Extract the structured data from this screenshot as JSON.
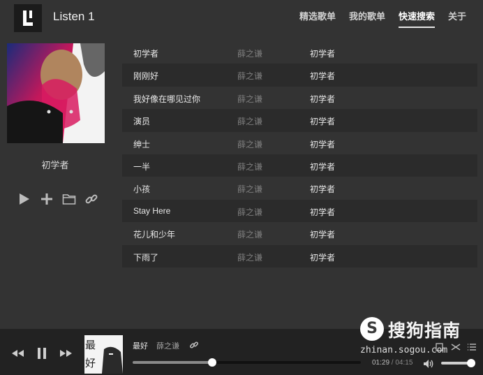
{
  "app": {
    "title": "Listen 1",
    "logo_text": "L"
  },
  "nav": {
    "items": [
      {
        "label": "精选歌单",
        "active": false
      },
      {
        "label": "我的歌单",
        "active": false
      },
      {
        "label": "快速搜索",
        "active": true
      },
      {
        "label": "关于",
        "active": false
      }
    ]
  },
  "sidebar": {
    "playlist_name": "初学者",
    "actions": [
      "play-all-icon",
      "add-icon",
      "folder-icon",
      "link-icon"
    ]
  },
  "songs": [
    {
      "title": "初学者",
      "artist": "薛之谦",
      "album": "初学者"
    },
    {
      "title": "刚刚好",
      "artist": "薛之谦",
      "album": "初学者"
    },
    {
      "title": "我好像在哪见过你",
      "artist": "薛之谦",
      "album": "初学者"
    },
    {
      "title": "演员",
      "artist": "薛之谦",
      "album": "初学者"
    },
    {
      "title": "绅士",
      "artist": "薛之谦",
      "album": "初学者"
    },
    {
      "title": "一半",
      "artist": "薛之谦",
      "album": "初学者"
    },
    {
      "title": "小孩",
      "artist": "薛之谦",
      "album": "初学者"
    },
    {
      "title": "Stay Here",
      "artist": "薛之谦",
      "album": "初学者"
    },
    {
      "title": "花儿和少年",
      "artist": "薛之谦",
      "album": "初学者"
    },
    {
      "title": "下雨了",
      "artist": "薛之谦",
      "album": "初学者"
    }
  ],
  "player": {
    "now_title": "最好",
    "now_artist": "薛之谦",
    "cover_text": "最\n好",
    "current_time": "01:29",
    "separator": " / ",
    "duration": "04:15",
    "progress": 0.349,
    "volume": 0.92
  },
  "watermark": {
    "brand": "搜狗指南",
    "url": "zhinan.sogou.com",
    "badge": "S"
  },
  "colors": {
    "background": "#333333",
    "row_alt": "#2b2b2b",
    "player_bar": "#222222",
    "accent": "#ffffff"
  }
}
